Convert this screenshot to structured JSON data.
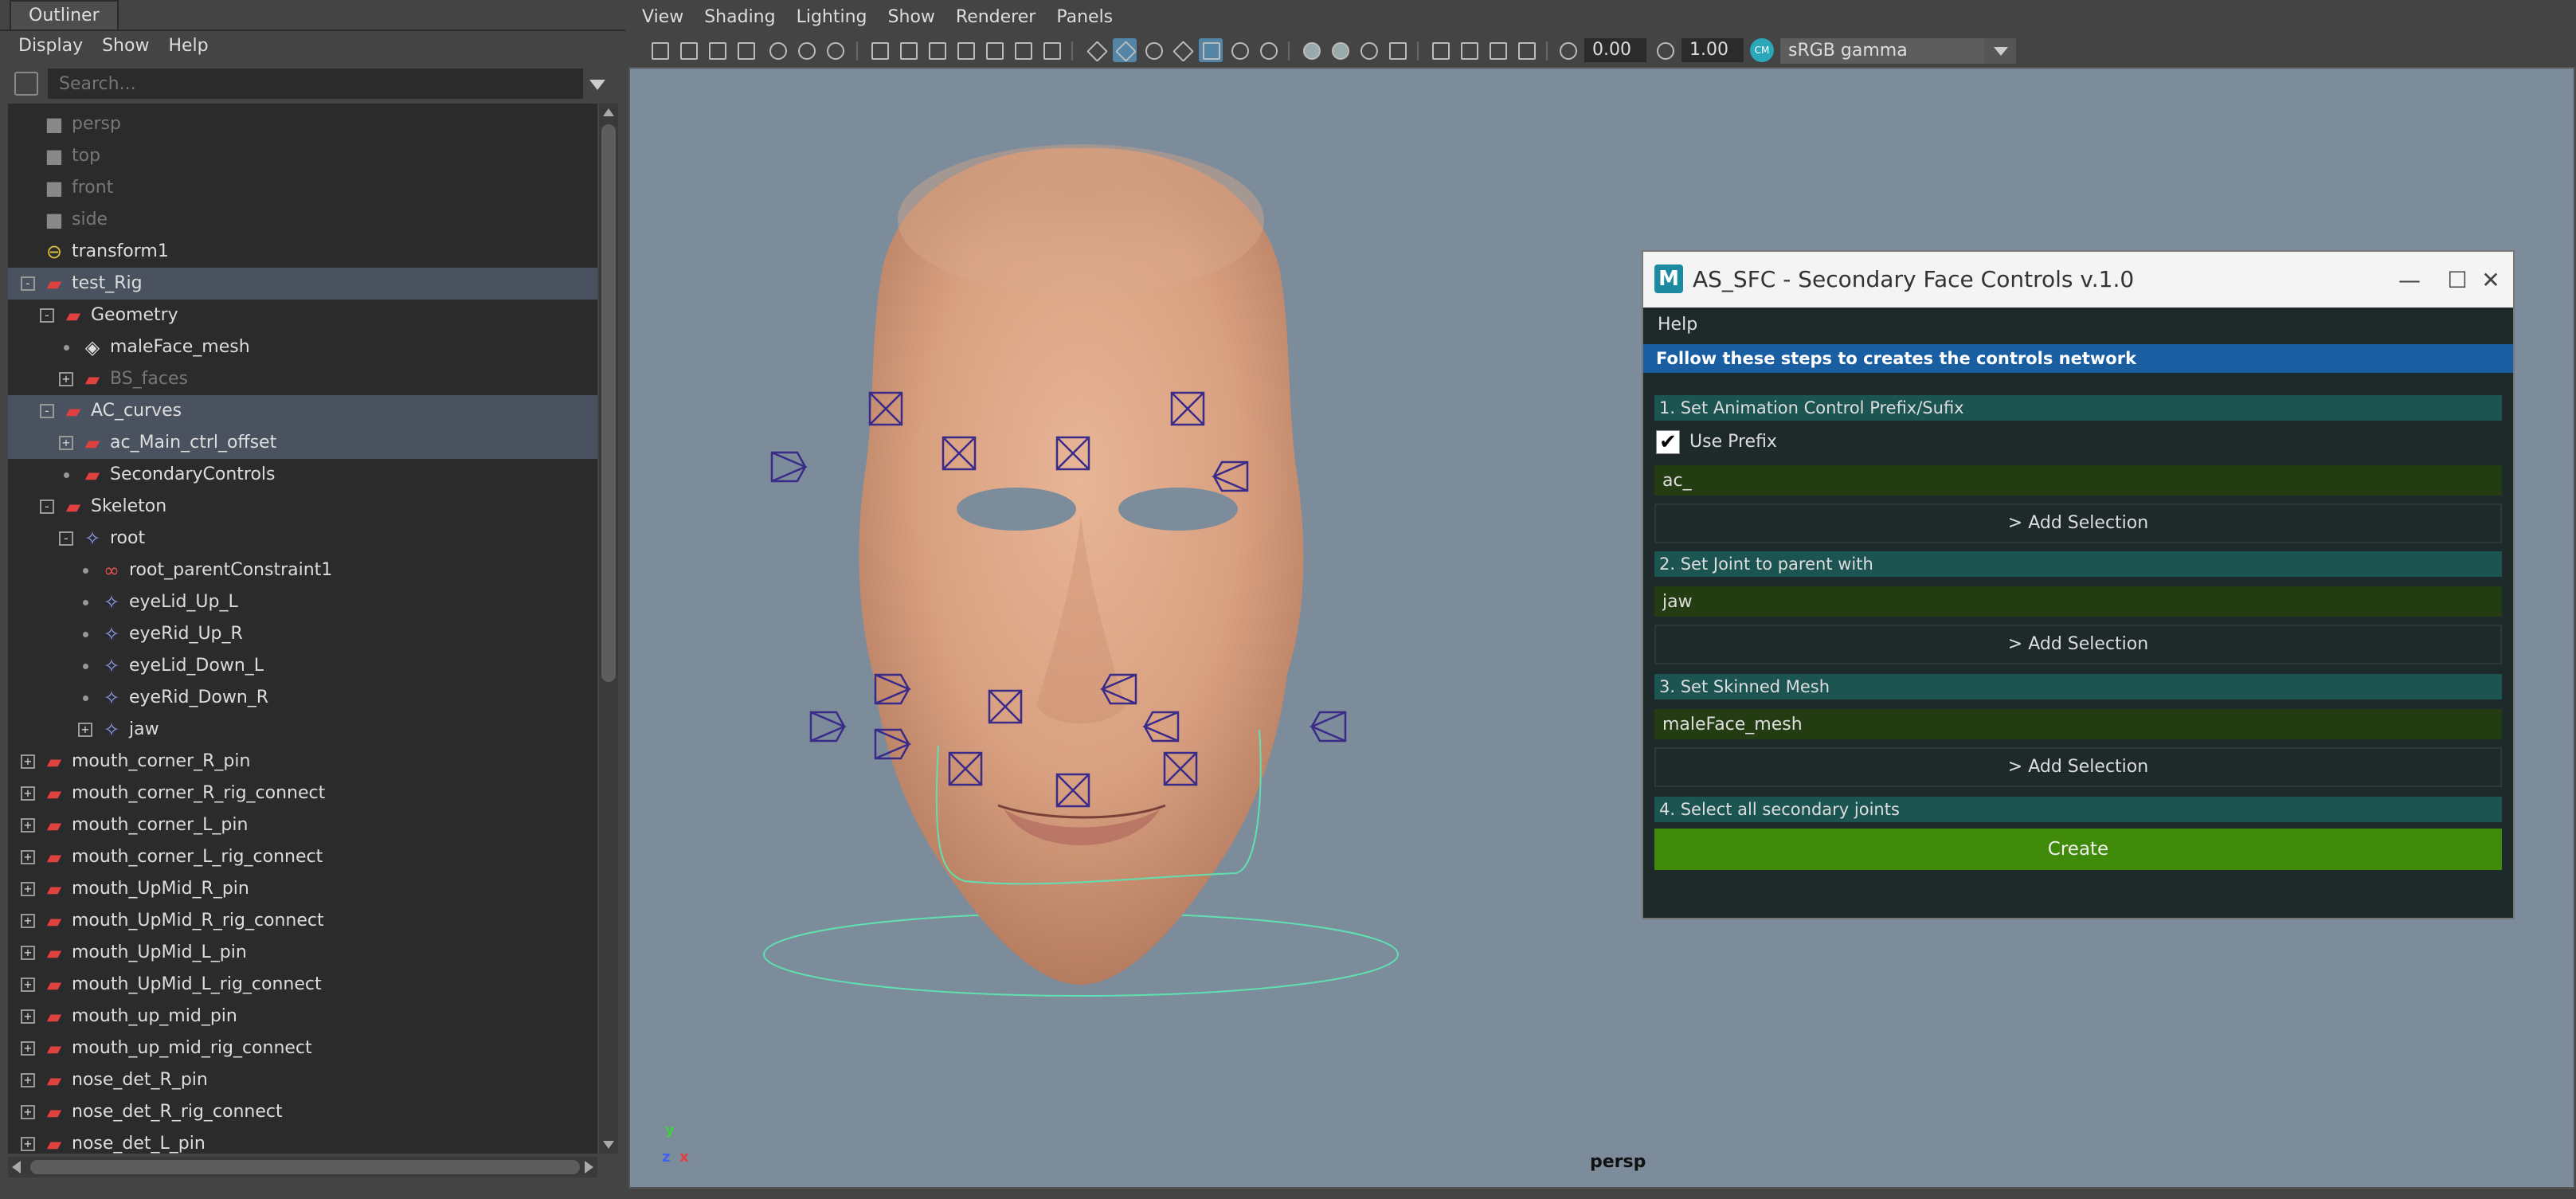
{
  "outliner": {
    "tab": "Outliner",
    "menu": [
      "Display",
      "Show",
      "Help"
    ],
    "search_placeholder": "Search...",
    "items": [
      {
        "label": "persp",
        "icon": "camera-icon",
        "depth": 0,
        "expander": "",
        "selected": false,
        "dim": true
      },
      {
        "label": "top",
        "icon": "camera-icon",
        "depth": 0,
        "expander": "",
        "selected": false,
        "dim": true
      },
      {
        "label": "front",
        "icon": "camera-icon",
        "depth": 0,
        "expander": "",
        "selected": false,
        "dim": true
      },
      {
        "label": "side",
        "icon": "camera-icon",
        "depth": 0,
        "expander": "",
        "selected": false,
        "dim": true
      },
      {
        "label": "transform1",
        "icon": "curve-icon",
        "depth": 0,
        "expander": "",
        "selected": false,
        "dim": false
      },
      {
        "label": "test_Rig",
        "icon": "transform-icon",
        "depth": 0,
        "expander": "-",
        "selected": true,
        "dim": false
      },
      {
        "label": "Geometry",
        "icon": "transform-icon",
        "depth": 1,
        "expander": "-",
        "selected": false,
        "dim": false
      },
      {
        "label": "maleFace_mesh",
        "icon": "mesh-icon",
        "depth": 2,
        "expander": "dot",
        "selected": false,
        "dim": false
      },
      {
        "label": "BS_faces",
        "icon": "transform-icon",
        "depth": 2,
        "expander": "+",
        "selected": false,
        "dim": true
      },
      {
        "label": "AC_curves",
        "icon": "transform-icon",
        "depth": 1,
        "expander": "-",
        "selected": true,
        "dim": false
      },
      {
        "label": "ac_Main_ctrl_offset",
        "icon": "transform-icon",
        "depth": 2,
        "expander": "+",
        "selected": true,
        "dim": false
      },
      {
        "label": "SecondaryControls",
        "icon": "transform-icon",
        "depth": 2,
        "expander": "dot",
        "selected": false,
        "dim": false
      },
      {
        "label": "Skeleton",
        "icon": "transform-icon",
        "depth": 1,
        "expander": "-",
        "selected": false,
        "dim": false
      },
      {
        "label": "root",
        "icon": "joint-icon",
        "depth": 2,
        "expander": "-",
        "selected": false,
        "dim": false
      },
      {
        "label": "root_parentConstraint1",
        "icon": "constraint-icon",
        "depth": 3,
        "expander": "dot",
        "selected": false,
        "dim": false
      },
      {
        "label": "eyeLid_Up_L",
        "icon": "joint-icon",
        "depth": 3,
        "expander": "dot",
        "selected": false,
        "dim": false
      },
      {
        "label": "eyeRid_Up_R",
        "icon": "joint-icon",
        "depth": 3,
        "expander": "dot",
        "selected": false,
        "dim": false
      },
      {
        "label": "eyeLid_Down_L",
        "icon": "joint-icon",
        "depth": 3,
        "expander": "dot",
        "selected": false,
        "dim": false
      },
      {
        "label": "eyeRid_Down_R",
        "icon": "joint-icon",
        "depth": 3,
        "expander": "dot",
        "selected": false,
        "dim": false
      },
      {
        "label": "jaw",
        "icon": "joint-icon",
        "depth": 3,
        "expander": "+",
        "selected": false,
        "dim": false
      },
      {
        "label": "mouth_corner_R_pin",
        "icon": "transform-icon",
        "depth": 0,
        "expander": "+",
        "selected": false,
        "dim": false
      },
      {
        "label": "mouth_corner_R_rig_connect",
        "icon": "transform-icon",
        "depth": 0,
        "expander": "+",
        "selected": false,
        "dim": false
      },
      {
        "label": "mouth_corner_L_pin",
        "icon": "transform-icon",
        "depth": 0,
        "expander": "+",
        "selected": false,
        "dim": false
      },
      {
        "label": "mouth_corner_L_rig_connect",
        "icon": "transform-icon",
        "depth": 0,
        "expander": "+",
        "selected": false,
        "dim": false
      },
      {
        "label": "mouth_UpMid_R_pin",
        "icon": "transform-icon",
        "depth": 0,
        "expander": "+",
        "selected": false,
        "dim": false
      },
      {
        "label": "mouth_UpMid_R_rig_connect",
        "icon": "transform-icon",
        "depth": 0,
        "expander": "+",
        "selected": false,
        "dim": false
      },
      {
        "label": "mouth_UpMid_L_pin",
        "icon": "transform-icon",
        "depth": 0,
        "expander": "+",
        "selected": false,
        "dim": false
      },
      {
        "label": "mouth_UpMid_L_rig_connect",
        "icon": "transform-icon",
        "depth": 0,
        "expander": "+",
        "selected": false,
        "dim": false
      },
      {
        "label": "mouth_up_mid_pin",
        "icon": "transform-icon",
        "depth": 0,
        "expander": "+",
        "selected": false,
        "dim": false
      },
      {
        "label": "mouth_up_mid_rig_connect",
        "icon": "transform-icon",
        "depth": 0,
        "expander": "+",
        "selected": false,
        "dim": false
      },
      {
        "label": "nose_det_R_pin",
        "icon": "transform-icon",
        "depth": 0,
        "expander": "+",
        "selected": false,
        "dim": false
      },
      {
        "label": "nose_det_R_rig_connect",
        "icon": "transform-icon",
        "depth": 0,
        "expander": "+",
        "selected": false,
        "dim": false
      },
      {
        "label": "nose_det_L_pin",
        "icon": "transform-icon",
        "depth": 0,
        "expander": "+",
        "selected": false,
        "dim": false
      }
    ]
  },
  "viewport": {
    "menu": [
      "View",
      "Shading",
      "Lighting",
      "Show",
      "Renderer",
      "Panels"
    ],
    "exposure": "0.00",
    "gamma": "1.00",
    "color_space": "sRGB gamma",
    "camera_label": "persp",
    "axis": {
      "y": "y",
      "z": "z",
      "x": "x"
    },
    "background_color": "#7c8c9b"
  },
  "dialog": {
    "title": "AS_SFC - Secondary Face Controls v.1.0",
    "menu": "Help",
    "banner": "Follow these steps to creates the controls network",
    "step1": "1. Set Animation Control Prefix/Sufix",
    "use_prefix_label": "Use Prefix",
    "use_prefix_checked": "✔",
    "prefix_value": "ac_",
    "add_selection": "> Add Selection",
    "step2": "2. Set Joint to parent with",
    "joint_value": "jaw",
    "step3": "3. Set Skinned Mesh",
    "mesh_value": "maleFace_mesh",
    "step4": "4. Select all secondary joints",
    "create_label": "Create",
    "colors": {
      "banner": "#1a5ea2",
      "section": "#1c5452",
      "field": "#243c12",
      "create": "#3f8a08"
    }
  }
}
